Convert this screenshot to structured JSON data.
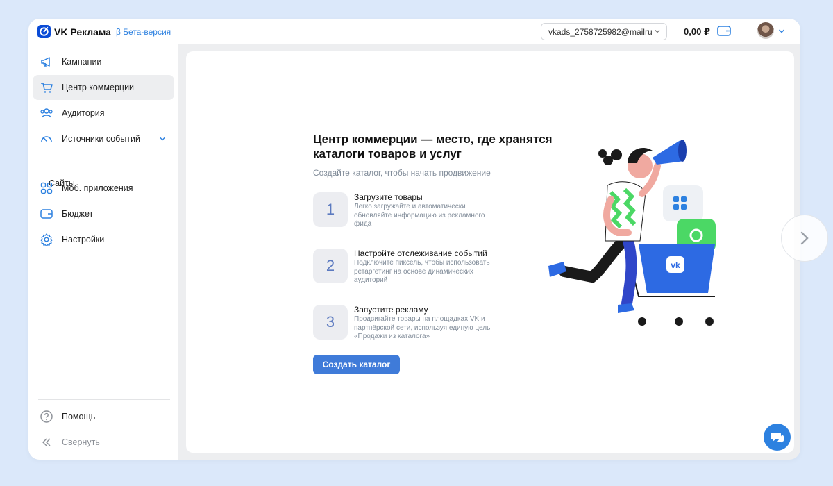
{
  "header": {
    "app_name": "VK Реклама",
    "beta_label": "β Бета-версия",
    "account": "vkads_2758725982@mailru",
    "balance": "0,00 ₽"
  },
  "sidebar": {
    "items": [
      {
        "label": "Кампании",
        "icon": "megaphone-icon"
      },
      {
        "label": "Центр коммерции",
        "icon": "cart-icon",
        "active": true
      },
      {
        "label": "Аудитория",
        "icon": "users-icon"
      },
      {
        "label": "Источники событий",
        "icon": "gauge-icon",
        "expanded": true
      },
      {
        "label": "Моб. приложения",
        "icon": "apps-grid-icon"
      },
      {
        "label": "Бюджет",
        "icon": "wallet-icon"
      },
      {
        "label": "Настройки",
        "icon": "gear-icon"
      }
    ],
    "subitem": "Сайты",
    "help": "Помощь",
    "collapse": "Свернуть"
  },
  "main": {
    "headline": "Центр коммерции — место, где хранятся каталоги товаров и услуг",
    "subtitle": "Создайте каталог, чтобы начать продвижение",
    "steps": [
      {
        "num": "1",
        "title": "Загрузите товары",
        "desc": "Легко загружайте и автоматически обновляйте информацию из рекламного фида"
      },
      {
        "num": "2",
        "title": "Настройте отслеживание событий",
        "desc": "Подключите пиксель, чтобы использовать ретаргетинг на основе динамических аудиторий"
      },
      {
        "num": "3",
        "title": "Запустите рекламу",
        "desc": "Продвигайте товары на площадках VK и партнёрской сети, используя единую цель «Продажи из каталога»"
      }
    ],
    "cta": "Создать каталог"
  },
  "colors": {
    "accent": "#2d81e0",
    "button": "#3f7bd9",
    "page_bg": "#dbe8fa"
  }
}
